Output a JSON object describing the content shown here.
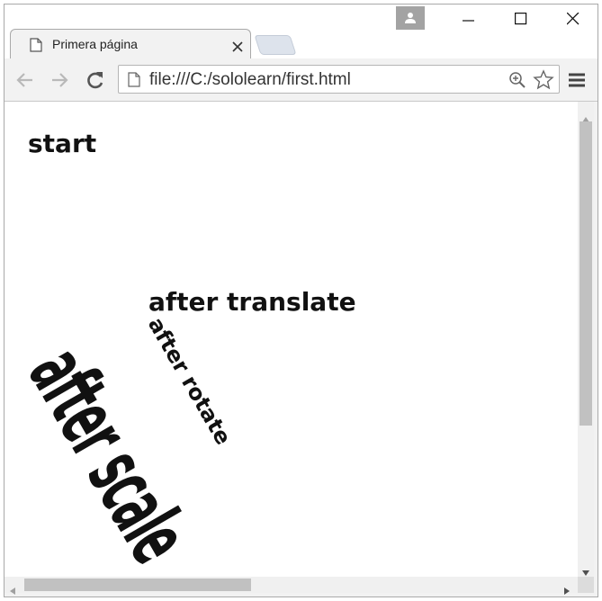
{
  "tab": {
    "title": "Primera página"
  },
  "address_bar": {
    "url": "file:///C:/sololearn/first.html"
  },
  "page": {
    "texts": {
      "start": "start",
      "translate": "after translate",
      "rotate": "after rotate",
      "scale": "after scale"
    }
  },
  "icons": {
    "tab_page": "page-icon",
    "tab_close": "close-icon",
    "profile": "person-icon",
    "minimize": "minimize-icon",
    "maximize": "maximize-icon",
    "close": "close-icon",
    "back": "arrow-left-icon",
    "forward": "arrow-right-icon",
    "reload": "reload-icon",
    "file": "page-icon",
    "zoom": "zoom-in-icon",
    "bookmark": "star-icon",
    "menu": "hamburger-icon"
  },
  "colors": {
    "frame": "#ffffff",
    "toolbar": "#f2f2f2",
    "profile_button": "#a3a3a3",
    "scroll_thumb": "#c1c1c1"
  }
}
